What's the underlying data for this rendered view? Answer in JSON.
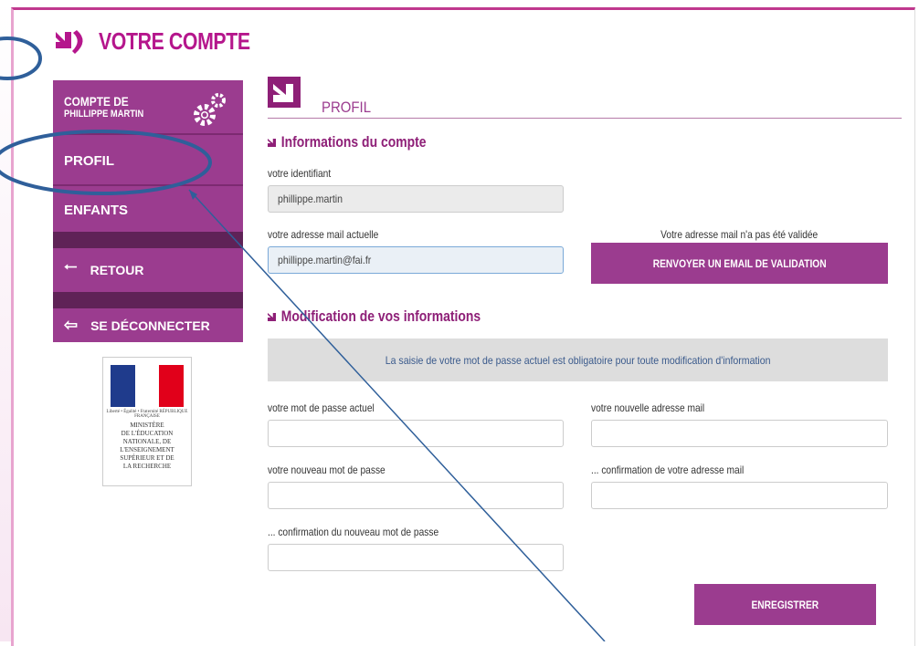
{
  "app": {
    "title": "VOTRE COMPTE"
  },
  "sidebar": {
    "account_line1": "COMPTE DE",
    "account_line2": "PHILLIPPE MARTIN",
    "items": [
      {
        "label": "PROFIL",
        "icon": "none"
      },
      {
        "label": "ENFANTS",
        "icon": "none"
      },
      {
        "label": "RETOUR",
        "icon": "arrow-left-icon"
      },
      {
        "label": "SE DÉCONNECTER",
        "icon": "logout-icon"
      }
    ]
  },
  "ministry": {
    "republic": "Liberté • Égalité • Fraternité RÉPUBLIQUE FRANÇAISE",
    "lines": [
      "MINISTÈRE",
      "DE L'ÉDUCATION",
      "NATIONALE, DE",
      "L'ENSEIGNEMENT",
      "SUPÉRIEUR ET DE",
      "LA RECHERCHE"
    ],
    "flag_colors": [
      "#1f3b8c",
      "#ffffff",
      "#e1001a"
    ]
  },
  "profil": {
    "title": "PROFIL"
  },
  "account_info": {
    "section_title": "Informations du compte",
    "identifier_label": "votre identifiant",
    "identifier_value": "phillippe.martin",
    "email_label": "votre adresse mail actuelle",
    "email_value": "phillippe.martin@fai.fr",
    "email_warning": "Votre adresse mail n'a pas été validée",
    "resend_button": "RENVOYER UN EMAIL DE VALIDATION"
  },
  "modify": {
    "section_title": "Modification de vos informations",
    "notice": "La saisie de votre mot de passe actuel est obligatoire pour toute modification d'information",
    "current_password_label": "votre mot de passe actuel",
    "new_password_label": "votre nouveau mot de passe",
    "confirm_password_label": "... confirmation du nouveau mot de passe",
    "new_email_label": "votre nouvelle adresse mail",
    "confirm_email_label": "... confirmation de votre adresse mail",
    "save_button": "ENREGISTRER"
  },
  "colors": {
    "accent": "#9b3c8f",
    "brand": "#b5168c",
    "annotation": "#2f5f9a"
  }
}
